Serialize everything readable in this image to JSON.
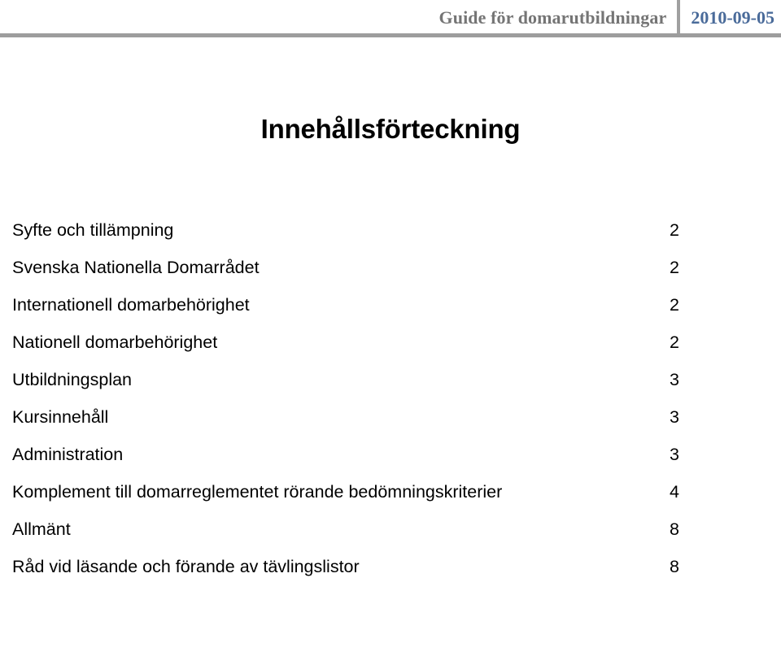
{
  "header": {
    "document_title": "Guide för domarutbildningar",
    "date": "2010-09-05",
    "title_color": "#757575",
    "date_color": "#4a6b9a",
    "rule_color": "#9d9d9d",
    "divider_color": "#a0a0a0"
  },
  "main": {
    "heading": "Innehållsförteckning",
    "toc": [
      {
        "label": "Syfte och tillämpning",
        "page": "2"
      },
      {
        "label": "Svenska Nationella Domarrådet",
        "page": "2"
      },
      {
        "label": "Internationell domarbehörighet",
        "page": "2"
      },
      {
        "label": "Nationell domarbehörighet",
        "page": "2"
      },
      {
        "label": "Utbildningsplan",
        "page": "3"
      },
      {
        "label": "Kursinnehåll",
        "page": "3"
      },
      {
        "label": "Administration",
        "page": "3"
      },
      {
        "label": "Komplement till domarreglementet rörande bedömningskriterier",
        "page": "4"
      },
      {
        "label": "Allmänt",
        "page": "8"
      },
      {
        "label": "Råd vid läsande och förande av tävlingslistor",
        "page": "8"
      }
    ]
  }
}
